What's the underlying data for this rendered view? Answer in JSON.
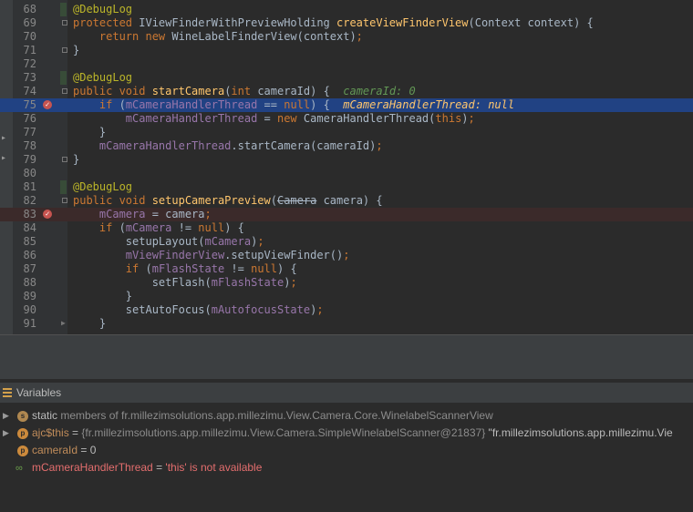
{
  "editor": {
    "lines": [
      {
        "n": "68",
        "tokens": [
          {
            "t": "@DebugLog",
            "c": "t-ann"
          }
        ]
      },
      {
        "n": "69",
        "tokens": [
          {
            "t": "protected ",
            "c": "t-kw"
          },
          {
            "t": "IViewFinderWithPreviewHolding ",
            "c": "t-plain"
          },
          {
            "t": "createViewFinderView",
            "c": "t-fn"
          },
          {
            "t": "(Context context) {",
            "c": "t-plain"
          }
        ]
      },
      {
        "n": "70",
        "tokens": [
          {
            "t": "    return new ",
            "c": "t-kw"
          },
          {
            "t": "WineLabelFinderView(context)",
            "c": "t-plain"
          },
          {
            "t": ";",
            "c": "t-kw"
          }
        ]
      },
      {
        "n": "71",
        "tokens": [
          {
            "t": "}",
            "c": "t-plain"
          }
        ]
      },
      {
        "n": "72",
        "tokens": []
      },
      {
        "n": "73",
        "tokens": [
          {
            "t": "@DebugLog",
            "c": "t-ann"
          }
        ]
      },
      {
        "n": "74",
        "tokens": [
          {
            "t": "public void ",
            "c": "t-kw"
          },
          {
            "t": "startCamera",
            "c": "t-fn"
          },
          {
            "t": "(",
            "c": "t-plain"
          },
          {
            "t": "int ",
            "c": "t-kw"
          },
          {
            "t": "cameraId) {  ",
            "c": "t-plain"
          },
          {
            "t": "cameraId: 0",
            "c": "t-hint"
          }
        ]
      },
      {
        "n": "75",
        "tokens": [
          {
            "t": "    if ",
            "c": "t-kw"
          },
          {
            "t": "(",
            "c": "t-plain"
          },
          {
            "t": "mCameraHandlerThread",
            "c": "t-field"
          },
          {
            "t": " == ",
            "c": "t-plain"
          },
          {
            "t": "null",
            "c": "t-kw"
          },
          {
            "t": ") {  ",
            "c": "t-plain"
          },
          {
            "t": "mCameraHandlerThread: null",
            "c": "t-hinty"
          }
        ]
      },
      {
        "n": "76",
        "tokens": [
          {
            "t": "        mCameraHandlerThread",
            "c": "t-field"
          },
          {
            "t": " = ",
            "c": "t-plain"
          },
          {
            "t": "new ",
            "c": "t-kw"
          },
          {
            "t": "CameraHandlerThread(",
            "c": "t-plain"
          },
          {
            "t": "this",
            "c": "t-kw"
          },
          {
            "t": ")",
            "c": "t-plain"
          },
          {
            "t": ";",
            "c": "t-kw"
          }
        ]
      },
      {
        "n": "77",
        "tokens": [
          {
            "t": "    }",
            "c": "t-plain"
          }
        ]
      },
      {
        "n": "78",
        "tokens": [
          {
            "t": "    mCameraHandlerThread",
            "c": "t-field"
          },
          {
            "t": ".startCamera(cameraId)",
            "c": "t-plain"
          },
          {
            "t": ";",
            "c": "t-kw"
          }
        ]
      },
      {
        "n": "79",
        "tokens": [
          {
            "t": "}",
            "c": "t-plain"
          }
        ]
      },
      {
        "n": "80",
        "tokens": []
      },
      {
        "n": "81",
        "tokens": [
          {
            "t": "@DebugLog",
            "c": "t-ann"
          }
        ]
      },
      {
        "n": "82",
        "tokens": [
          {
            "t": "public void ",
            "c": "t-kw"
          },
          {
            "t": "setupCameraPreview",
            "c": "t-fn"
          },
          {
            "t": "(",
            "c": "t-plain"
          },
          {
            "t": "Camera",
            "c": "t-plain t-strike"
          },
          {
            "t": " camera) {",
            "c": "t-plain"
          }
        ]
      },
      {
        "n": "83",
        "tokens": [
          {
            "t": "    mCamera",
            "c": "t-field"
          },
          {
            "t": " = camera",
            "c": "t-plain"
          },
          {
            "t": ";",
            "c": "t-kw"
          }
        ]
      },
      {
        "n": "84",
        "tokens": [
          {
            "t": "    if ",
            "c": "t-kw"
          },
          {
            "t": "(",
            "c": "t-plain"
          },
          {
            "t": "mCamera",
            "c": "t-field"
          },
          {
            "t": " != ",
            "c": "t-plain"
          },
          {
            "t": "null",
            "c": "t-kw"
          },
          {
            "t": ") {",
            "c": "t-plain"
          }
        ]
      },
      {
        "n": "85",
        "tokens": [
          {
            "t": "        setupLayout(",
            "c": "t-plain"
          },
          {
            "t": "mCamera",
            "c": "t-field"
          },
          {
            "t": ")",
            "c": "t-plain"
          },
          {
            "t": ";",
            "c": "t-kw"
          }
        ]
      },
      {
        "n": "86",
        "tokens": [
          {
            "t": "        mViewFinderView",
            "c": "t-field"
          },
          {
            "t": ".setupViewFinder()",
            "c": "t-plain"
          },
          {
            "t": ";",
            "c": "t-kw"
          }
        ]
      },
      {
        "n": "87",
        "tokens": [
          {
            "t": "        if ",
            "c": "t-kw"
          },
          {
            "t": "(",
            "c": "t-plain"
          },
          {
            "t": "mFlashState",
            "c": "t-field"
          },
          {
            "t": " != ",
            "c": "t-plain"
          },
          {
            "t": "null",
            "c": "t-kw"
          },
          {
            "t": ") {",
            "c": "t-plain"
          }
        ]
      },
      {
        "n": "88",
        "tokens": [
          {
            "t": "            setFlash(",
            "c": "t-plain"
          },
          {
            "t": "mFlashState",
            "c": "t-field"
          },
          {
            "t": ")",
            "c": "t-plain"
          },
          {
            "t": ";",
            "c": "t-kw"
          }
        ]
      },
      {
        "n": "89",
        "tokens": [
          {
            "t": "        }",
            "c": "t-plain"
          }
        ]
      },
      {
        "n": "90",
        "tokens": [
          {
            "t": "        setAutoFocus(",
            "c": "t-plain"
          },
          {
            "t": "mAutofocusState",
            "c": "t-field"
          },
          {
            "t": ")",
            "c": "t-plain"
          },
          {
            "t": ";",
            "c": "t-kw"
          }
        ]
      },
      {
        "n": "91",
        "tokens": [
          {
            "t": "    }",
            "c": "t-plain"
          }
        ]
      }
    ]
  },
  "variables": {
    "title": "Variables",
    "rows": [
      {
        "kind": "static",
        "icon": "s",
        "expandable": true,
        "parts": [
          {
            "t": "static",
            "c": "v-plain"
          },
          {
            "t": " members of fr.millezimsolutions.app.millezimu.View.Camera.Core.WinelabelScannerView",
            "c": "v-gray"
          }
        ]
      },
      {
        "kind": "field",
        "icon": "p",
        "expandable": true,
        "parts": [
          {
            "t": "ajc$this",
            "c": "v-name"
          },
          {
            "t": " = ",
            "c": "v-plain"
          },
          {
            "t": "{fr.millezimsolutions.app.millezimu.View.Camera.SimpleWinelabelScanner@21837}",
            "c": "v-gray"
          },
          {
            "t": " \"fr.millezimsolutions.app.millezimu.Vie",
            "c": "v-plain"
          }
        ]
      },
      {
        "kind": "field",
        "icon": "p",
        "expandable": false,
        "parts": [
          {
            "t": "cameraId",
            "c": "v-name"
          },
          {
            "t": " = 0",
            "c": "v-plain"
          }
        ]
      },
      {
        "kind": "watch",
        "icon": "watch",
        "expandable": false,
        "parts": [
          {
            "t": "mCameraHandlerThread",
            "c": "v-name-red"
          },
          {
            "t": " = ",
            "c": "v-plain"
          },
          {
            "t": "'this' is not available",
            "c": "v-str"
          }
        ]
      }
    ]
  }
}
